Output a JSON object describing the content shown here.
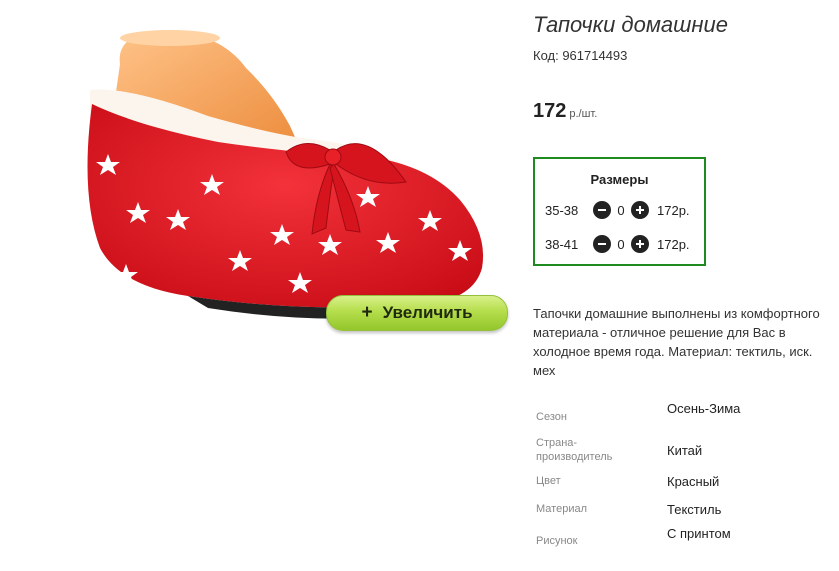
{
  "product": {
    "title": "Тапочки домашние",
    "code": "Код: 961714493",
    "price": "172",
    "price_unit": "р./шт.",
    "zoom_label": "Увеличить",
    "zoom_icon": "+"
  },
  "sizes": {
    "title": "Размеры",
    "rows": [
      {
        "label": "35-38",
        "qty": "0",
        "price": "172р."
      },
      {
        "label": "38-41",
        "qty": "0",
        "price": "172р."
      }
    ]
  },
  "description": [
    "Тапочки домашние выполнены из комфортного",
    "материала - отличное решение для Вас в",
    "холодное время года. Материал: тектиль, иск.",
    "мех"
  ],
  "specs": [
    {
      "label": "Сезон",
      "value": "Осень-Зима"
    },
    {
      "label": "Страна-производитель",
      "value": "Китай"
    },
    {
      "label": "Цвет",
      "value": "Красный"
    },
    {
      "label": "Материал",
      "value": "Текстиль"
    },
    {
      "label": "Рисунок",
      "value": "С принтом"
    }
  ],
  "colors": {
    "accent_border": "#1f8a1f",
    "zoom_button": "#b5de4c",
    "slipper": "#e0141e"
  },
  "icons": {
    "zoom": "plus-icon",
    "decrease": "minus-circle-icon",
    "increase": "plus-circle-icon"
  }
}
